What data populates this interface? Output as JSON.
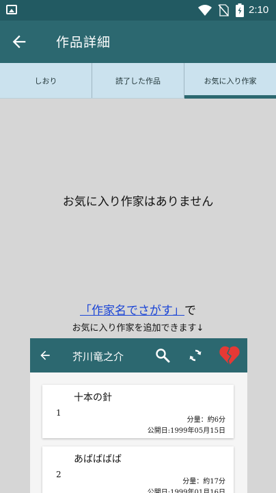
{
  "status_bar": {
    "time": "2:10",
    "icons": [
      "image-icon",
      "wifi-icon",
      "no-sim-icon",
      "battery-icon"
    ]
  },
  "app_bar": {
    "title": "作品詳細",
    "back_icon": "arrow-left-icon"
  },
  "tabs": [
    {
      "label": "しおり",
      "active": false
    },
    {
      "label": "読了した作品",
      "active": false
    },
    {
      "label": "お気に入り作家",
      "active": true
    }
  ],
  "empty_message": "お気に入り作家はありません",
  "hint": {
    "link_text": "「作家名でさがす」",
    "suffix": "で",
    "line2": "お気に入り作家を追加できます↓"
  },
  "preview": {
    "toolbar_title": "芥川竜之介",
    "icons": [
      "arrow-left-icon",
      "search-icon",
      "refresh-icon",
      "heart-icon"
    ],
    "works": [
      {
        "num": "1",
        "title": "十本の針",
        "amount": "分量：約6分",
        "date": "公開日:1999年05月15日"
      },
      {
        "num": "2",
        "title": "あばばばば",
        "amount": "分量：約17分",
        "date": "公開日:1999年01月16日"
      }
    ]
  },
  "colors": {
    "status_bar": "#225a62",
    "app_bar": "#2c6870",
    "tabs_bg": "#cbe2ee",
    "body_bg": "#d6d6d6",
    "link": "#1a44d6",
    "heart": "#e53935"
  }
}
